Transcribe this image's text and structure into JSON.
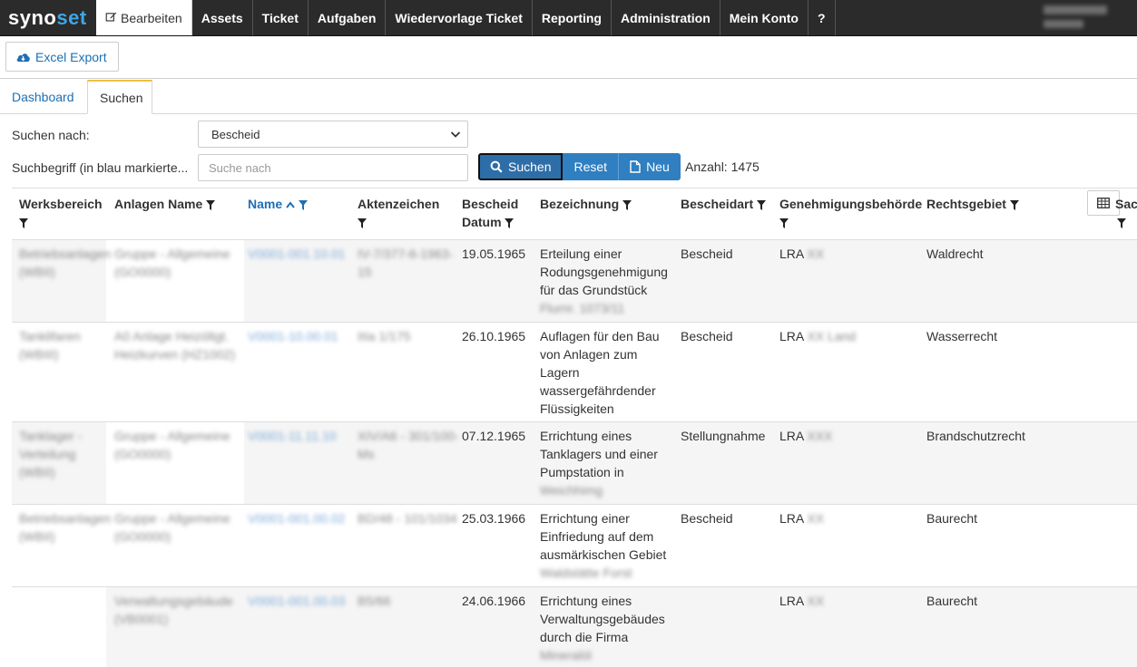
{
  "app": {
    "logo_part1": "syno",
    "logo_part2": "set"
  },
  "nav": {
    "items": [
      {
        "label": "Bearbeiten",
        "active": true
      },
      {
        "label": "Assets"
      },
      {
        "label": "Ticket"
      },
      {
        "label": "Aufgaben"
      },
      {
        "label": "Wiedervorlage Ticket"
      },
      {
        "label": "Reporting"
      },
      {
        "label": "Administration"
      },
      {
        "label": "Mein Konto"
      },
      {
        "label": "?"
      }
    ]
  },
  "toolbar": {
    "excel_label": "Excel Export"
  },
  "tabs": [
    {
      "label": "Dashboard"
    },
    {
      "label": "Suchen",
      "active": true
    }
  ],
  "search": {
    "search_by_label": "Suchen nach:",
    "search_by_value": "Bescheid",
    "term_label": "Suchbegriff (in blau markierte...",
    "term_placeholder": "Suche nach",
    "search_button": "Suchen",
    "reset_button": "Reset",
    "new_button": "Neu",
    "count_text": "Anzahl: 1475"
  },
  "table": {
    "headers": {
      "werksbereich": "Werksbereich",
      "anlagen_name": "Anlagen Name",
      "name": "Name",
      "aktenzeichen": "Aktenzeichen",
      "bescheid_datum_1": "Bescheid",
      "bescheid_datum_2": "Datum",
      "bezeichnung": "Bezeichnung",
      "bescheidart": "Bescheidart",
      "behoerde": "Genehmigungsbehörde",
      "rechtsgebiet": "Rechtsgebiet",
      "sach": "Sach"
    },
    "rows": [
      {
        "datum": "19.05.1965",
        "bez": [
          "Erteilung einer",
          "Rodungsgenehmigung",
          "für das Grundstück"
        ],
        "art": "Bescheid",
        "beh": "LRA",
        "recht": "Waldrecht"
      },
      {
        "datum": "26.10.1965",
        "bez": [
          "Auflagen für den Bau",
          "von Anlagen zum",
          "Lagern",
          "wassergefährdender",
          "Flüssigkeiten"
        ],
        "art": "Bescheid",
        "beh": "LRA",
        "recht": "Wasserrecht"
      },
      {
        "datum": "07.12.1965",
        "bez": [
          "Errichtung eines",
          "Tanklagers und einer",
          "Pumpstation in"
        ],
        "art": "Stellungnahme",
        "beh": "LRA",
        "recht": "Brandschutzrecht"
      },
      {
        "datum": "25.03.1966",
        "bez": [
          "Errichtung einer",
          "Einfriedung auf dem",
          "ausmärkischen Gebiet"
        ],
        "art": "Bescheid",
        "beh": "LRA",
        "recht": "Baurecht"
      },
      {
        "datum": "24.06.1966",
        "bez": [
          "Errichtung eines",
          "Verwaltungsgebäudes",
          "durch die Firma"
        ],
        "art": "",
        "beh": "LRA",
        "recht": "Baurecht"
      }
    ]
  }
}
